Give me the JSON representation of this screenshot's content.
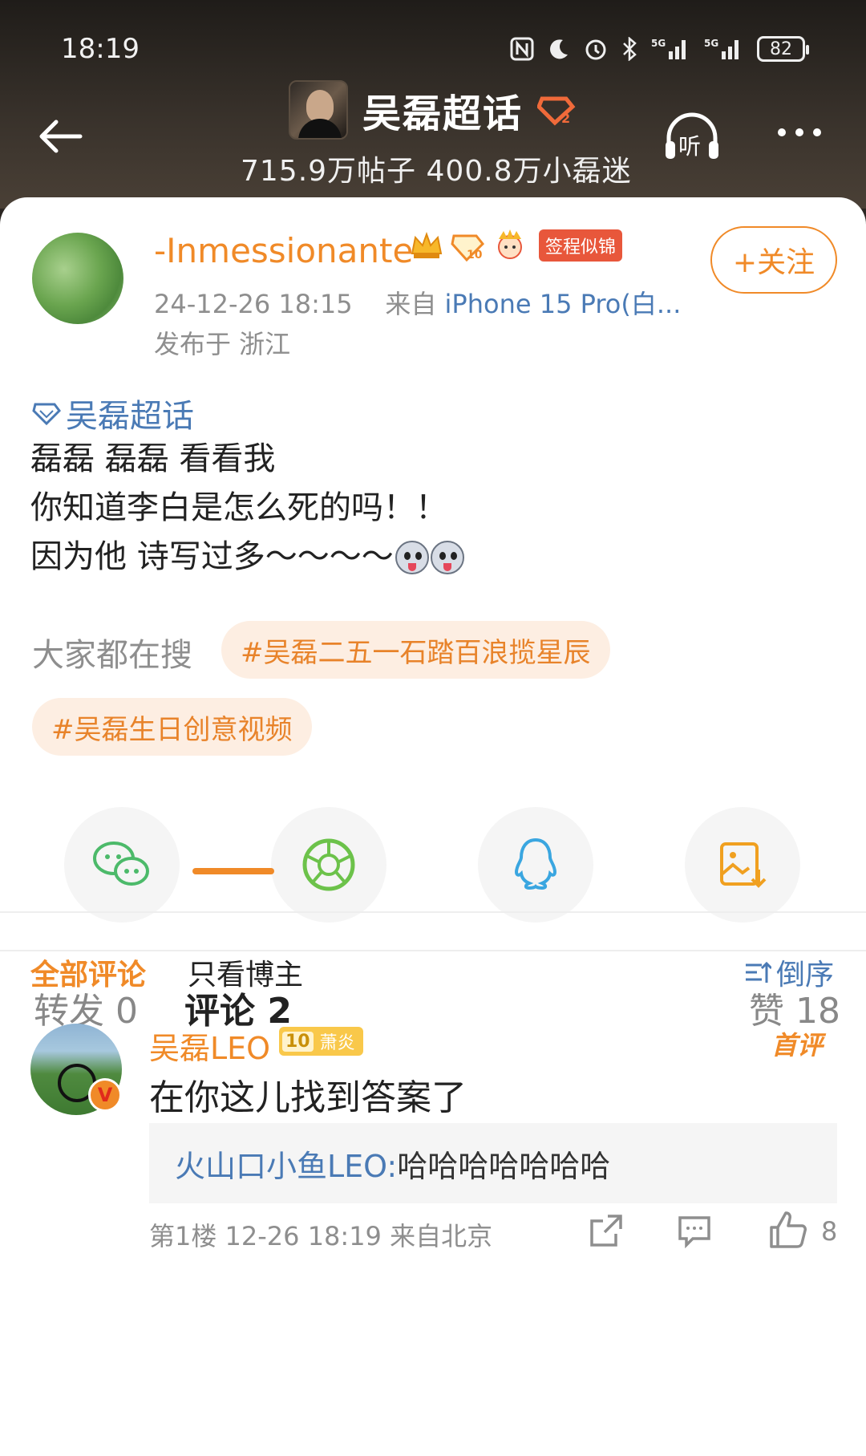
{
  "status": {
    "time": "18:19",
    "battery": "82"
  },
  "header": {
    "title": "吴磊超话",
    "stats": "715.9万帖子 400.8万小磊迷",
    "listen_label": "听"
  },
  "post": {
    "username": "-Inmessionante",
    "tag_badge": "签程似锦",
    "follow_label": "+关注",
    "time": "24-12-26 18:15",
    "source_prefix": "来自",
    "device": "iPhone 15 Pro(白...",
    "location": "发布于 浙江",
    "topic": "吴磊超话",
    "lines": [
      "磊磊 磊磊 看看我",
      "你知道李白是怎么死的吗！！",
      "因为他 诗写过多～～～～"
    ],
    "search_label": "大家都在搜",
    "hot_searches": [
      "#吴磊二五一石踏百浪揽星辰",
      "#吴磊生日创意视频"
    ]
  },
  "share": [
    {
      "icon": "wechat-icon",
      "color": "#4cba6a"
    },
    {
      "icon": "moments-icon",
      "color": "#6cc24a"
    },
    {
      "icon": "qq-icon",
      "color": "#3aa6e0"
    },
    {
      "icon": "save-image-icon",
      "color": "#f0a020"
    }
  ],
  "tabs": {
    "repost": "转发 0",
    "comments": "评论 2",
    "likes": "赞 18"
  },
  "filters": {
    "all": "全部评论",
    "author_only": "只看博主",
    "sort": "倒序"
  },
  "comment": {
    "username": "吴磊LEO",
    "fan_level": "10",
    "fan_badge": "萧炎",
    "first_label": "首评",
    "text": "在你这儿找到答案了",
    "reply_user": "火山口小鱼LEO:",
    "reply_text": " 哈哈哈哈哈哈哈",
    "meta": "第1楼  12-26 18:19  来自北京",
    "like_count": "8"
  },
  "colors": {
    "accent": "#f08a28",
    "link": "#4a7ab5"
  }
}
